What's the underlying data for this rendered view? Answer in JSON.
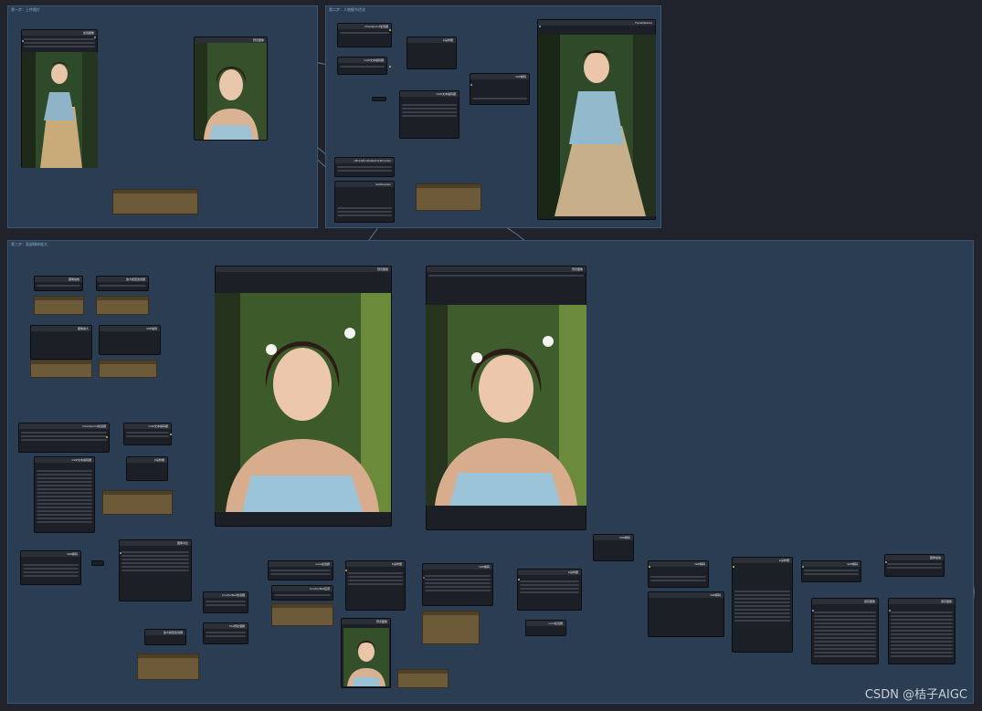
{
  "groups": [
    {
      "id": "g1",
      "title": "第一步：上传图片"
    },
    {
      "id": "g2",
      "title": "第二步：人物细节优化"
    },
    {
      "id": "g3",
      "title": "第三步：面部精修放大"
    }
  ],
  "nodes": [
    {
      "id": "n1",
      "title": "加载图像"
    },
    {
      "id": "n2",
      "title": "预览图像"
    },
    {
      "id": "n3",
      "title": "Checkpoint加载器"
    },
    {
      "id": "n4",
      "title": "CLIP文本编码器"
    },
    {
      "id": "n5",
      "title": "K采样器"
    },
    {
      "id": "n6",
      "title": "VAE解码"
    },
    {
      "id": "n7",
      "title": "CLIP文本编码器"
    },
    {
      "id": "n8",
      "title": "FaceDetailer"
    },
    {
      "id": "n9",
      "title": "UltralyticsDetectorProvider"
    },
    {
      "id": "n10",
      "title": "SAMLoader"
    },
    {
      "id": "n11",
      "title": "预览图像"
    },
    {
      "id": "n12",
      "title": "预览图像"
    },
    {
      "id": "n13",
      "title": "图像缩放"
    },
    {
      "id": "n14",
      "title": "放大模型加载器"
    },
    {
      "id": "n15",
      "title": "图像放大"
    },
    {
      "id": "n16",
      "title": "VAE编码"
    },
    {
      "id": "n17",
      "title": "Checkpoint加载器"
    },
    {
      "id": "n18",
      "title": "CLIP文本编码器"
    },
    {
      "id": "n19",
      "title": "CLIP文本编码器"
    },
    {
      "id": "n20",
      "title": "K采样器"
    },
    {
      "id": "n21",
      "title": "VAE解码"
    },
    {
      "id": "n22",
      "title": "图像对比"
    },
    {
      "id": "n23",
      "title": "Lora加载器"
    },
    {
      "id": "n24",
      "title": "ControlNet应用"
    },
    {
      "id": "n25",
      "title": "ControlNet加载器"
    },
    {
      "id": "n26",
      "title": "预览图像"
    },
    {
      "id": "n27",
      "title": "K采样器"
    },
    {
      "id": "n28",
      "title": "VAE解码"
    },
    {
      "id": "n29",
      "title": "保存图像"
    },
    {
      "id": "n30",
      "title": "保存图像"
    },
    {
      "id": "n31",
      "title": "Tile预处理器"
    },
    {
      "id": "n32",
      "title": "放大模型加载器"
    }
  ],
  "watermark": "CSDN @桔子AIGC",
  "colors": {
    "canvas": "#20232b",
    "group": "#2a3d52",
    "node": "#1c1f26",
    "note": "#6d5a38",
    "wire_blue": "#6a93b8",
    "wire_green": "#7fa34a"
  }
}
